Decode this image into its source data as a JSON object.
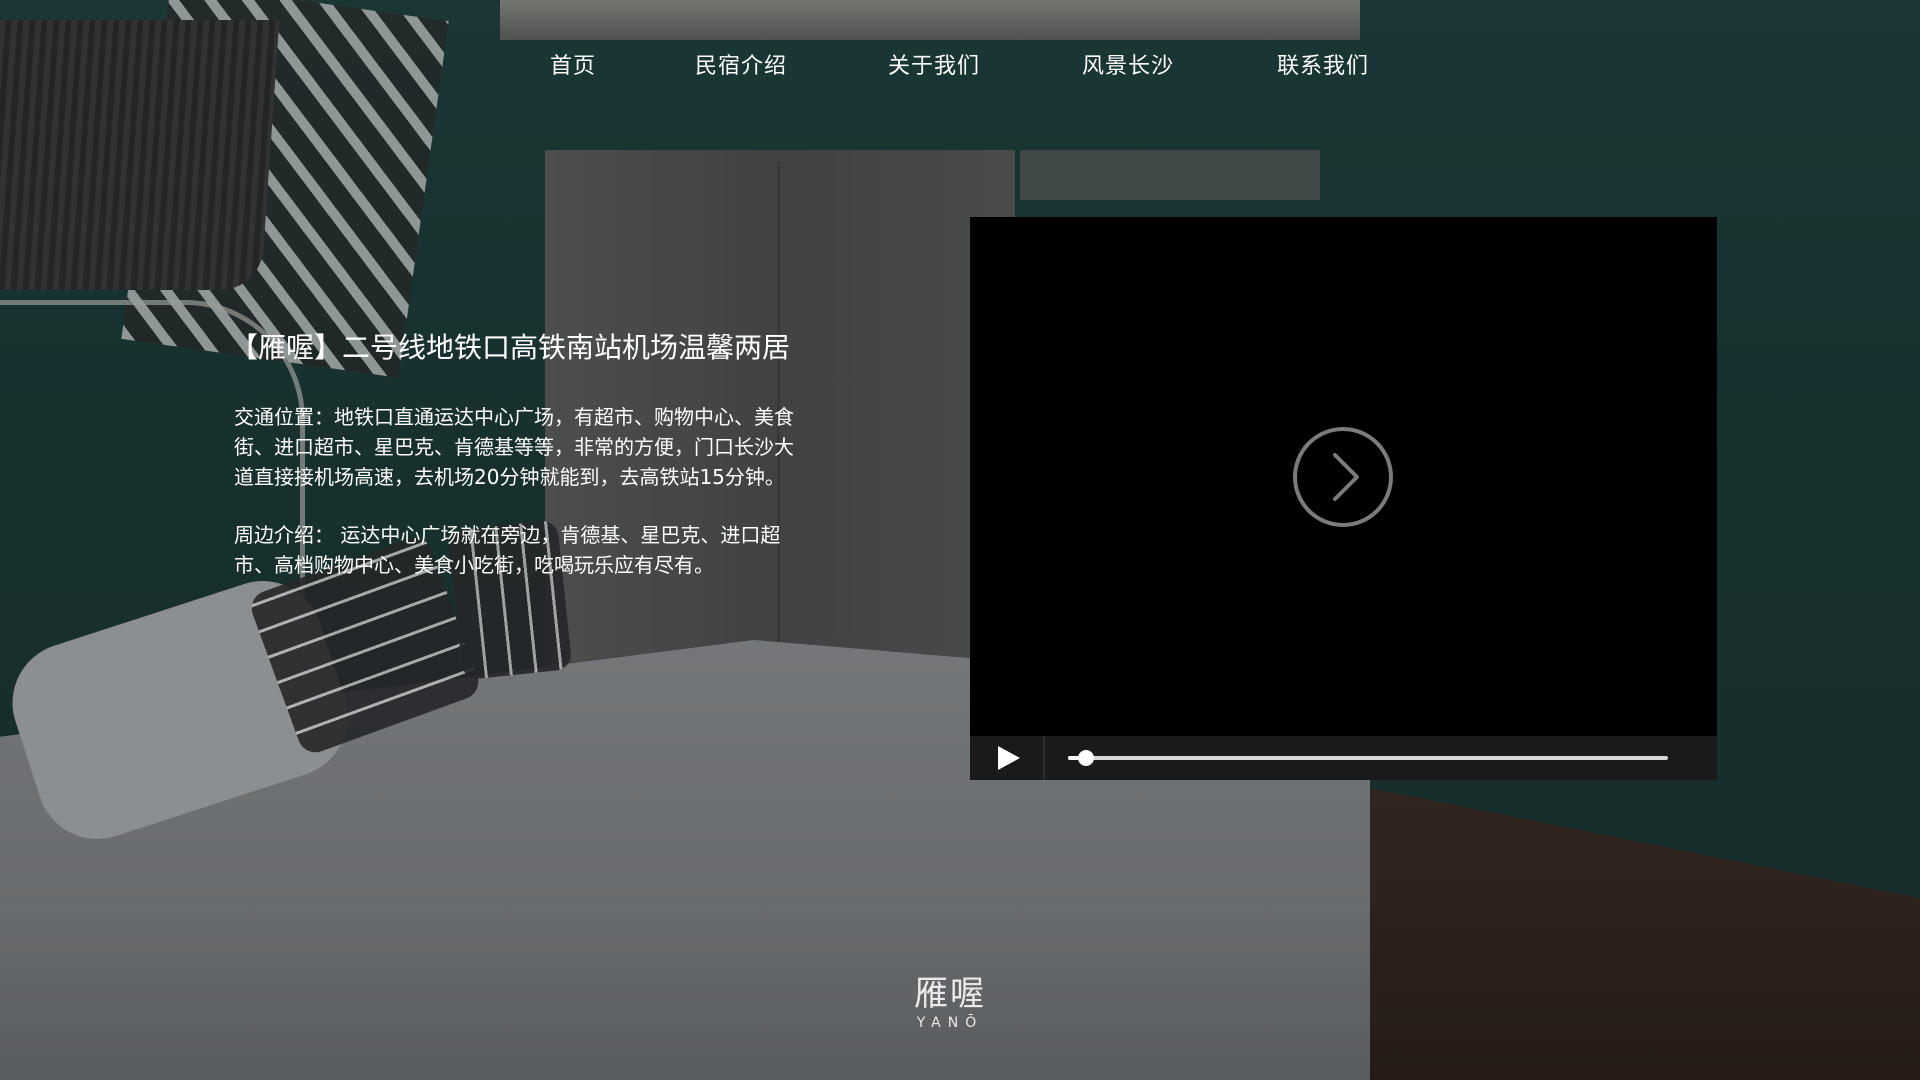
{
  "nav": {
    "items": [
      "首页",
      "民宿介绍",
      "关于我们",
      "风景长沙",
      "联系我们"
    ]
  },
  "intro": {
    "title": "【雁喔】二号线地铁口高铁南站机场温馨两居",
    "transport": "交通位置：地铁口直通运达中心广场，有超市、购物中心、美食街、进口超市、星巴克、肯德基等等，非常的方便，门口长沙大道直接接机场高速，去机场20分钟就能到，去高铁站15分钟。",
    "surroundings": "周边介绍： 运达中心广场就在旁边，肯德基、星巴克、进口超市、高档购物中心、美食小吃街，吃喝玩乐应有尽有。"
  },
  "player": {
    "overlay_icon": "play-circle-icon",
    "control_icon": "play-icon",
    "progress_fraction": 0.03
  },
  "logo": {
    "cn": "雁喔",
    "en": "YANŌ"
  }
}
